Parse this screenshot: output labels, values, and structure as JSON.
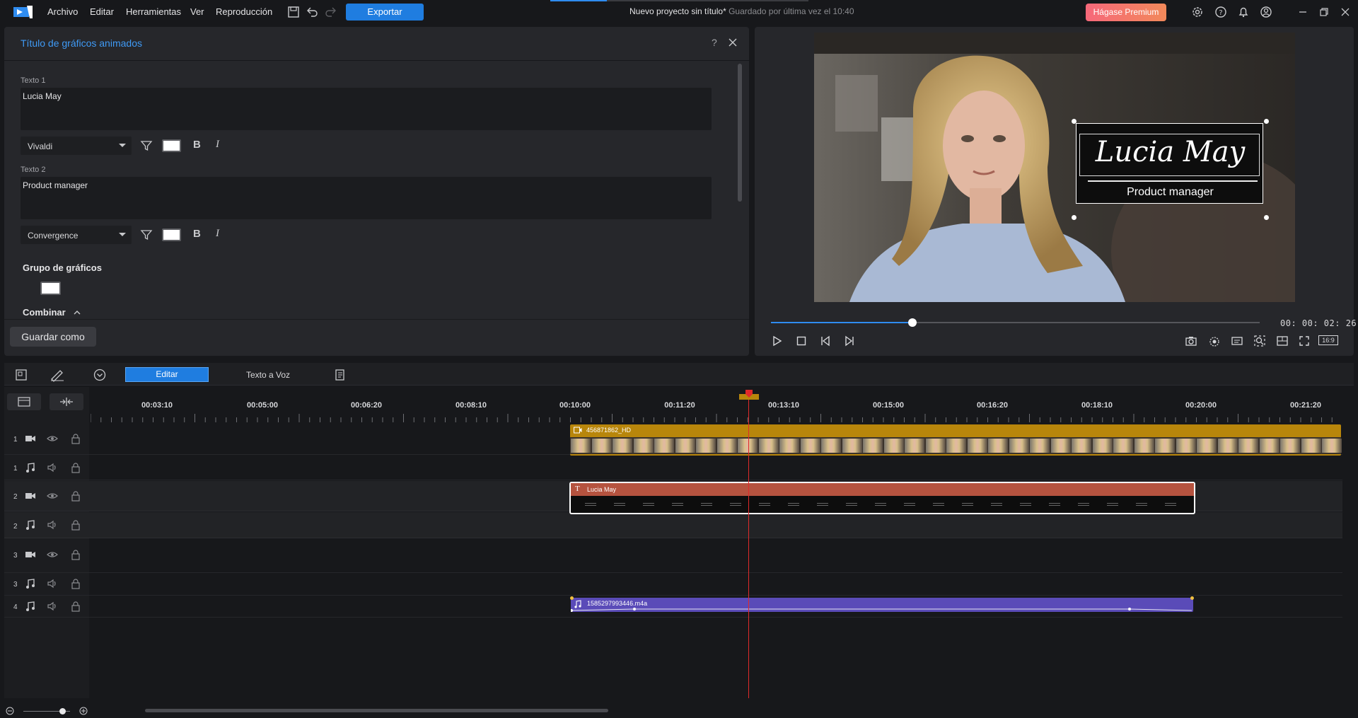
{
  "menu": {
    "items": [
      "Archivo",
      "Editar",
      "Herramientas",
      "Ver",
      "Reproducción"
    ],
    "export_label": "Exportar",
    "project_title": "Nuevo proyecto sin título*",
    "saved_status": "Guardado por última vez el 10:40",
    "premium_label": "Hágase Premium"
  },
  "panel": {
    "title": "Título de gráficos animados",
    "help": "?",
    "text1_label": "Texto 1",
    "text1_value": "Lucia May",
    "text1_font": "Vivaldi",
    "text2_label": "Texto 2",
    "text2_value": "Product manager",
    "text2_font": "Convergence",
    "group_label": "Grupo de gráficos",
    "combine_label": "Combinar",
    "save_as_label": "Guardar como",
    "bold_glyph": "B",
    "italic_glyph": "I"
  },
  "preview": {
    "overlay_name": "Lucia May",
    "overlay_role": "Product manager",
    "timecode": "00: 00: 02: 26",
    "aspect_label": "16:9",
    "progress": 0.29
  },
  "edit_toolbar": {
    "edit_tab": "Editar",
    "tts_tab": "Texto a Voz"
  },
  "timeline": {
    "ruler": [
      "00:03:10",
      "00:05:00",
      "00:06:20",
      "00:08:10",
      "00:10:00",
      "00:11:20",
      "00:13:10",
      "00:15:00",
      "00:16:20",
      "00:18:10",
      "00:20:00",
      "00:21:20"
    ],
    "tracks": [
      {
        "num": "1",
        "type": "video"
      },
      {
        "num": "1",
        "type": "audio"
      },
      {
        "num": "2",
        "type": "video"
      },
      {
        "num": "2",
        "type": "audio"
      },
      {
        "num": "3",
        "type": "video"
      },
      {
        "num": "3",
        "type": "audio"
      },
      {
        "num": "4",
        "type": "audio"
      }
    ],
    "clips": {
      "video_clip": "456871862_HD",
      "title_clip": "Lucia May",
      "audio_clip": "1585297993446.m4a"
    }
  },
  "colors": {
    "accent": "#1f7de0",
    "video_clip": "#b8860b",
    "title_clip": "#b5533f",
    "audio_clip": "#5a4bb8",
    "playhead": "#e02a2a"
  }
}
